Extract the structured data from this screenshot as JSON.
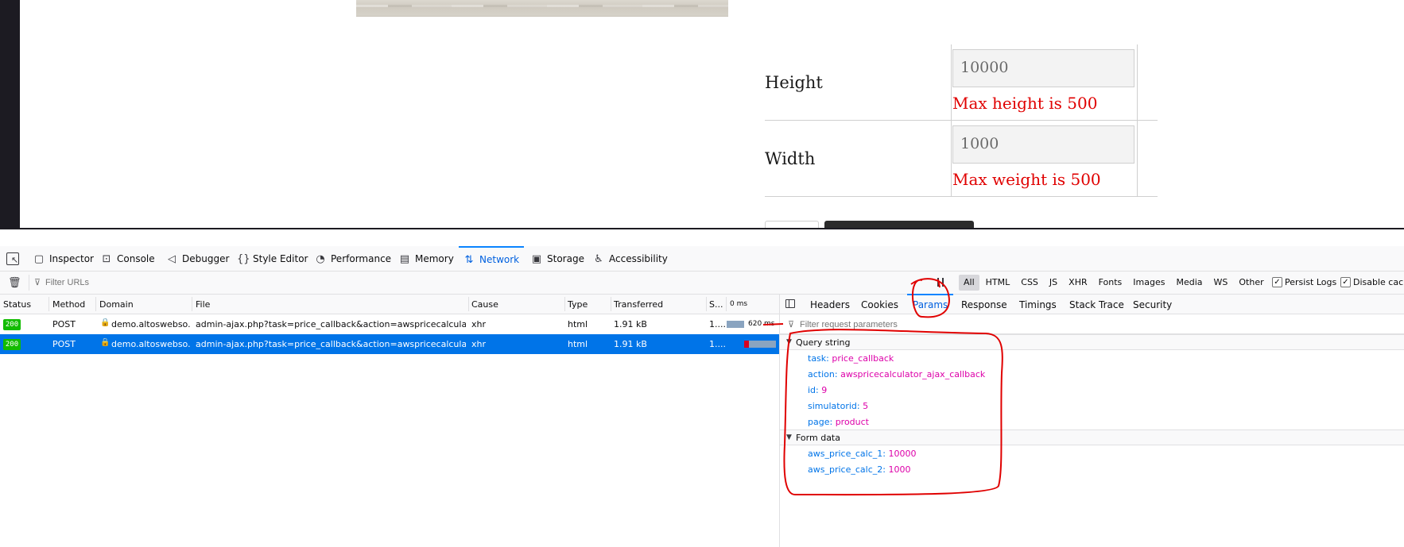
{
  "page": {
    "rows": [
      {
        "label": "Height",
        "value": "10000",
        "error": "Max height is 500"
      },
      {
        "label": "Width",
        "value": "1000",
        "error": "Max weight is 500"
      }
    ]
  },
  "devtools": {
    "tabs": [
      {
        "label": "Inspector",
        "icon": "inspector-icon"
      },
      {
        "label": "Console",
        "icon": "console-icon"
      },
      {
        "label": "Debugger",
        "icon": "debugger-icon"
      },
      {
        "label": "Style Editor",
        "icon": "style-editor-icon"
      },
      {
        "label": "Performance",
        "icon": "performance-icon"
      },
      {
        "label": "Memory",
        "icon": "memory-icon"
      },
      {
        "label": "Network",
        "icon": "network-icon"
      },
      {
        "label": "Storage",
        "icon": "storage-icon"
      },
      {
        "label": "Accessibility",
        "icon": "accessibility-icon"
      }
    ],
    "active_tab": "Network"
  },
  "filter": {
    "placeholder": "Filter URLs",
    "types": [
      "All",
      "HTML",
      "CSS",
      "JS",
      "XHR",
      "Fonts",
      "Images",
      "Media",
      "WS",
      "Other"
    ],
    "selected_type": "All",
    "persist_logs": "Persist Logs",
    "disable_cache": "Disable cach"
  },
  "requests": {
    "columns": [
      "Status",
      "Method",
      "Domain",
      "File",
      "Cause",
      "Type",
      "Transferred",
      "S...",
      "0 ms"
    ],
    "rows": [
      {
        "status": "200",
        "method": "POST",
        "domain": "demo.altoswebso...",
        "file": "admin-ajax.php?task=price_callback&action=awspricecalculator_...",
        "cause": "xhr",
        "type": "html",
        "transferred": "1.91 kB",
        "size": "1....",
        "timing": "620 ms",
        "selected": false
      },
      {
        "status": "200",
        "method": "POST",
        "domain": "demo.altoswebso...",
        "file": "admin-ajax.php?task=price_callback&action=awspricecalculator_...",
        "cause": "xhr",
        "type": "html",
        "transferred": "1.91 kB",
        "size": "1....",
        "timing": "",
        "selected": true
      }
    ]
  },
  "details": {
    "tabs": [
      "Headers",
      "Cookies",
      "Params",
      "Response",
      "Timings",
      "Stack Trace",
      "Security"
    ],
    "active_tab": "Params",
    "filter_placeholder": "Filter request parameters",
    "query_string": {
      "title": "Query string",
      "params": [
        {
          "key": "task:",
          "value": "price_callback"
        },
        {
          "key": "action:",
          "value": "awspricecalculator_ajax_callback"
        },
        {
          "key": "id:",
          "value": "9"
        },
        {
          "key": "simulatorid:",
          "value": "5"
        },
        {
          "key": "page:",
          "value": "product"
        }
      ]
    },
    "form_data": {
      "title": "Form data",
      "params": [
        {
          "key": "aws_price_calc_1:",
          "value": "10000"
        },
        {
          "key": "aws_price_calc_2:",
          "value": "1000"
        }
      ]
    }
  },
  "colors": {
    "accent": "#0a84ff",
    "selected_row": "#0074e8",
    "status_ok": "#12bc00",
    "param_key": "#0074e8",
    "param_value": "#dd00a9",
    "error_text": "#e00000",
    "annotation": "#e00000"
  }
}
